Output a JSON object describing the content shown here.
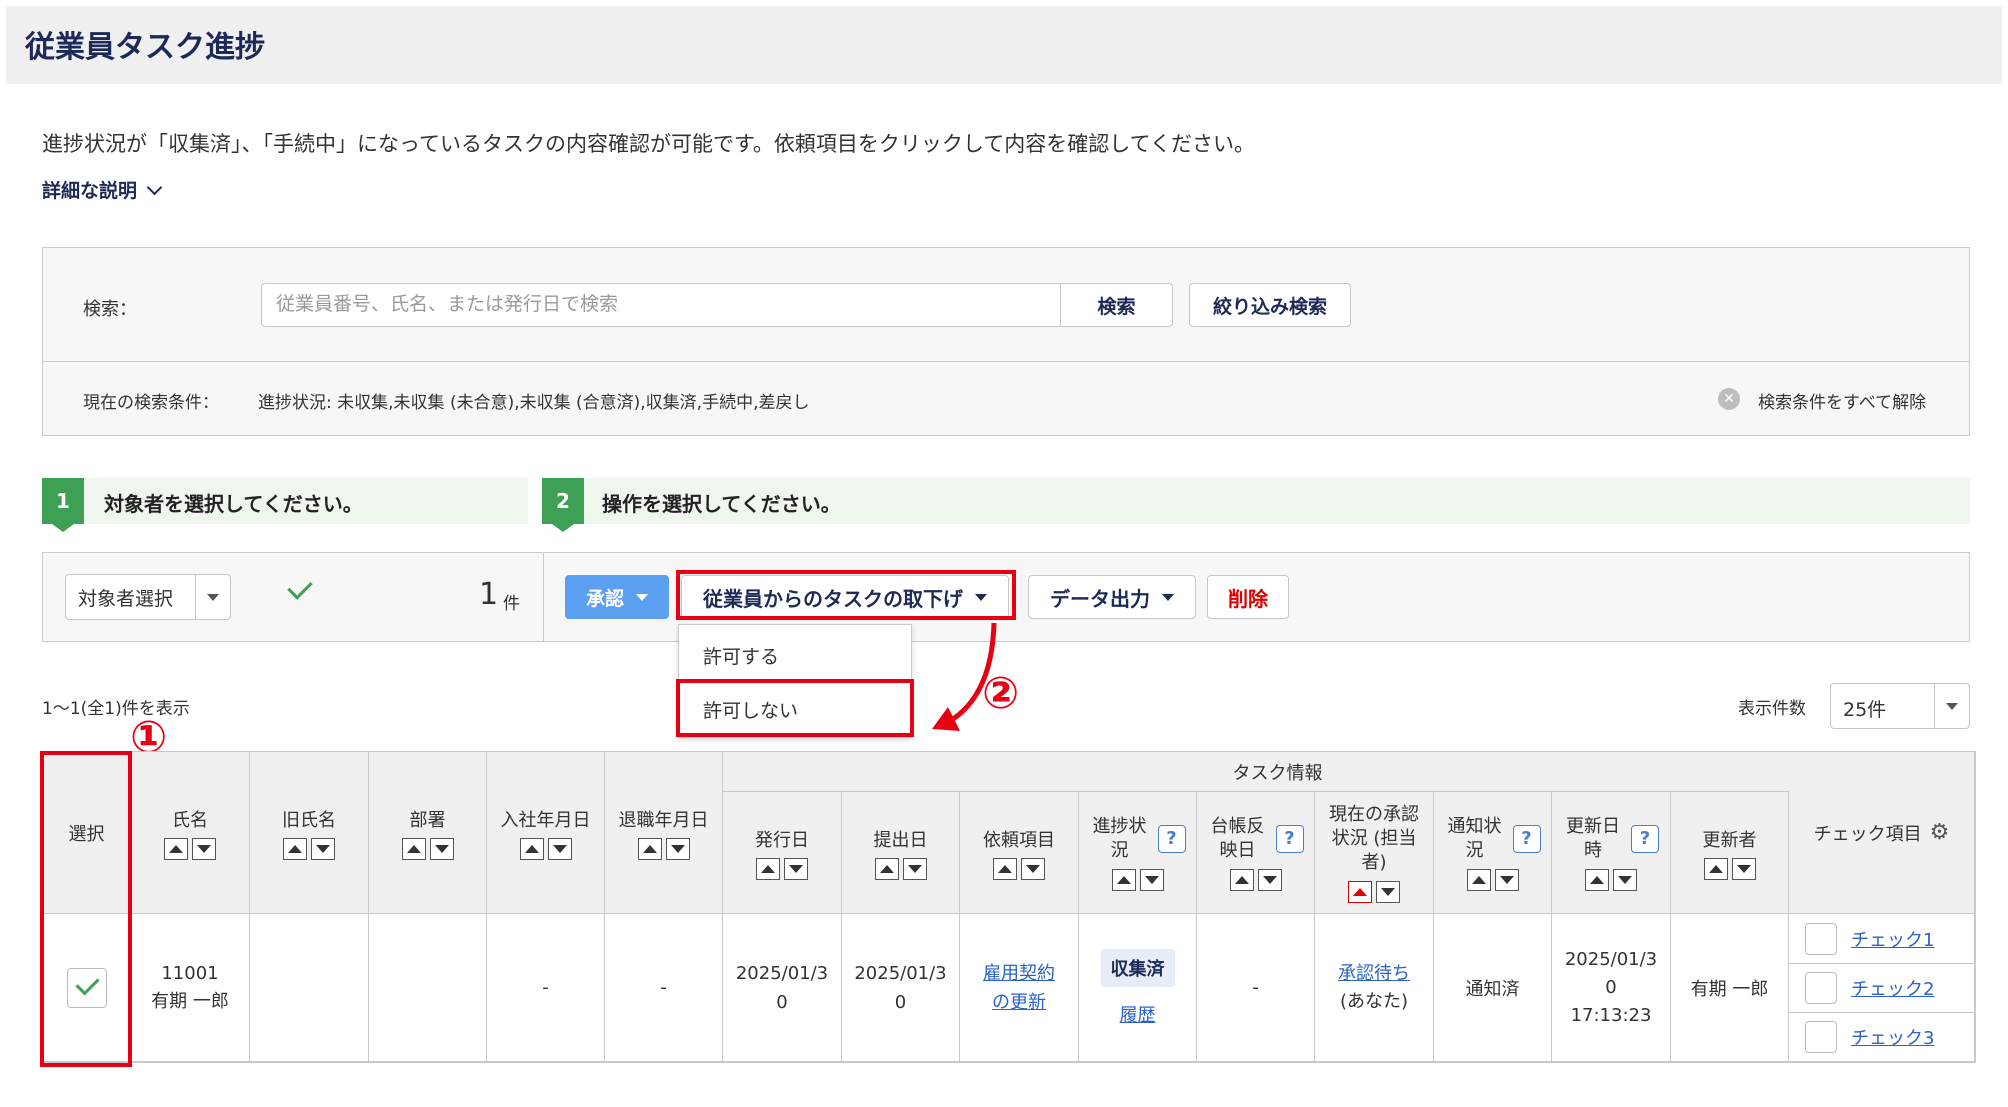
{
  "page_title": "従業員タスク進捗",
  "intro_text": "進捗状況が「収集済」、「手続中」になっているタスクの内容確認が可能です。依頼項目をクリックして内容を確認してください。",
  "detail_link": "詳細な説明",
  "search": {
    "label": "検索：",
    "placeholder": "従業員番号、氏名、または発行日で検索",
    "button": "検索",
    "filter_button": "絞り込み検索",
    "condition_label": "現在の検索条件：",
    "condition_value": "進捗状況: 未収集,未収集 (未合意),未収集 (合意済),収集済,手続中,差戻し",
    "clear_all": "検索条件をすべて解除"
  },
  "steps": [
    {
      "num": "1",
      "text": "対象者を選択してください。"
    },
    {
      "num": "2",
      "text": "操作を選択してください。"
    }
  ],
  "action_bar": {
    "target_select": "対象者選択",
    "count": "1",
    "count_unit": "件",
    "approve": "承認",
    "withdraw": "従業員からのタスクの取下げ",
    "export": "データ出力",
    "delete": "削除"
  },
  "withdraw_menu": [
    "許可する",
    "許可しない"
  ],
  "annotations": {
    "step1": "①",
    "step2": "②"
  },
  "pagination": {
    "range_text": "1～1(全1)件を表示",
    "per_page_label": "表示件数",
    "per_page_value": "25件"
  },
  "table": {
    "group_header": "タスク情報",
    "headers": {
      "select": "選択",
      "name": "氏名",
      "old_name": "旧氏名",
      "dept": "部署",
      "hire_date": "入社年月日",
      "leave_date": "退職年月日",
      "issue_date": "発行日",
      "submit_date": "提出日",
      "request_item": "依頼項目",
      "progress": "進捗状況",
      "ledger": "台帳反映日",
      "approval": "現在の承認状況 (担当者)",
      "notice": "通知状況",
      "updated_at": "更新日時",
      "updated_by": "更新者",
      "check_items": "チェック項目"
    },
    "row": {
      "emp_no": "11001",
      "name": "有期 一郎",
      "old_name": "",
      "dept": "",
      "hire_date": "-",
      "leave_date": "-",
      "issue_date": "2025/01/30",
      "submit_date": "2025/01/30",
      "request_item": "雇用契約の更新",
      "progress_badge": "収集済",
      "progress_history": "履歴",
      "ledger": "-",
      "approval_link": "承認待ち",
      "approval_who": "(あなた)",
      "notice": "通知済",
      "updated_date": "2025/01/30",
      "updated_time": "17:13:23",
      "updated_by": "有期 一郎",
      "checks": [
        "チェック1",
        "チェック2",
        "チェック3"
      ]
    }
  }
}
